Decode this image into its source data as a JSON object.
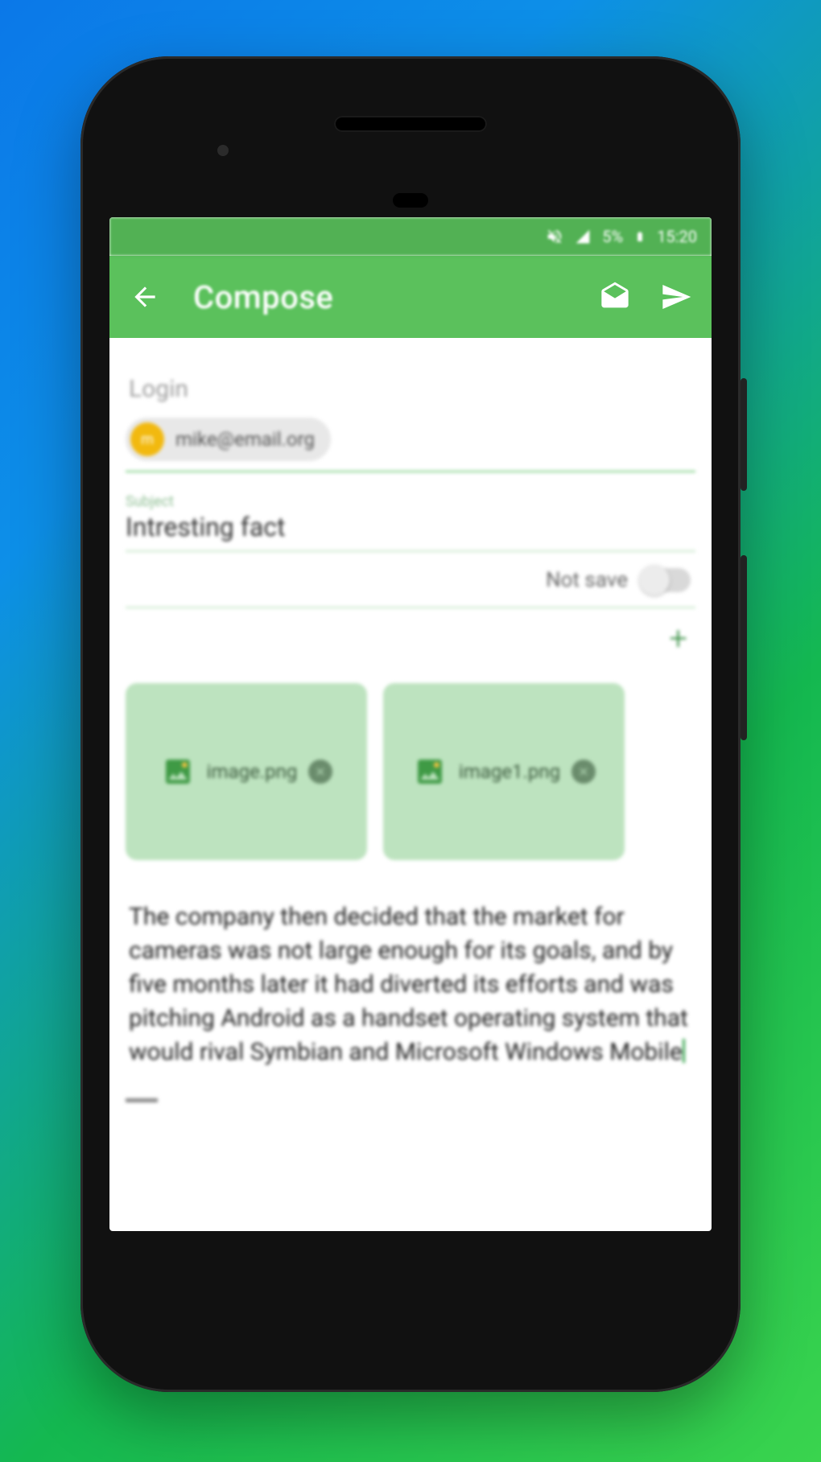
{
  "statusbar": {
    "battery_text": "5%",
    "time": "15:20"
  },
  "appbar": {
    "title": "Compose"
  },
  "compose": {
    "login_label": "Login",
    "recipient": "mike@email.org",
    "avatar_initial": "m",
    "subject_label": "Subject",
    "subject_value": "Intresting fact",
    "save_toggle_label": "Not save",
    "add_label": "+",
    "attachments": [
      {
        "name": "image.png"
      },
      {
        "name": "image1.png"
      }
    ],
    "body_text": "The company then decided that the market for cameras was not large enough for its goals, and by five months later it had diverted its efforts and was pitching Android as a handset operating system that would rival Symbian and Microsoft Windows Mobile"
  }
}
